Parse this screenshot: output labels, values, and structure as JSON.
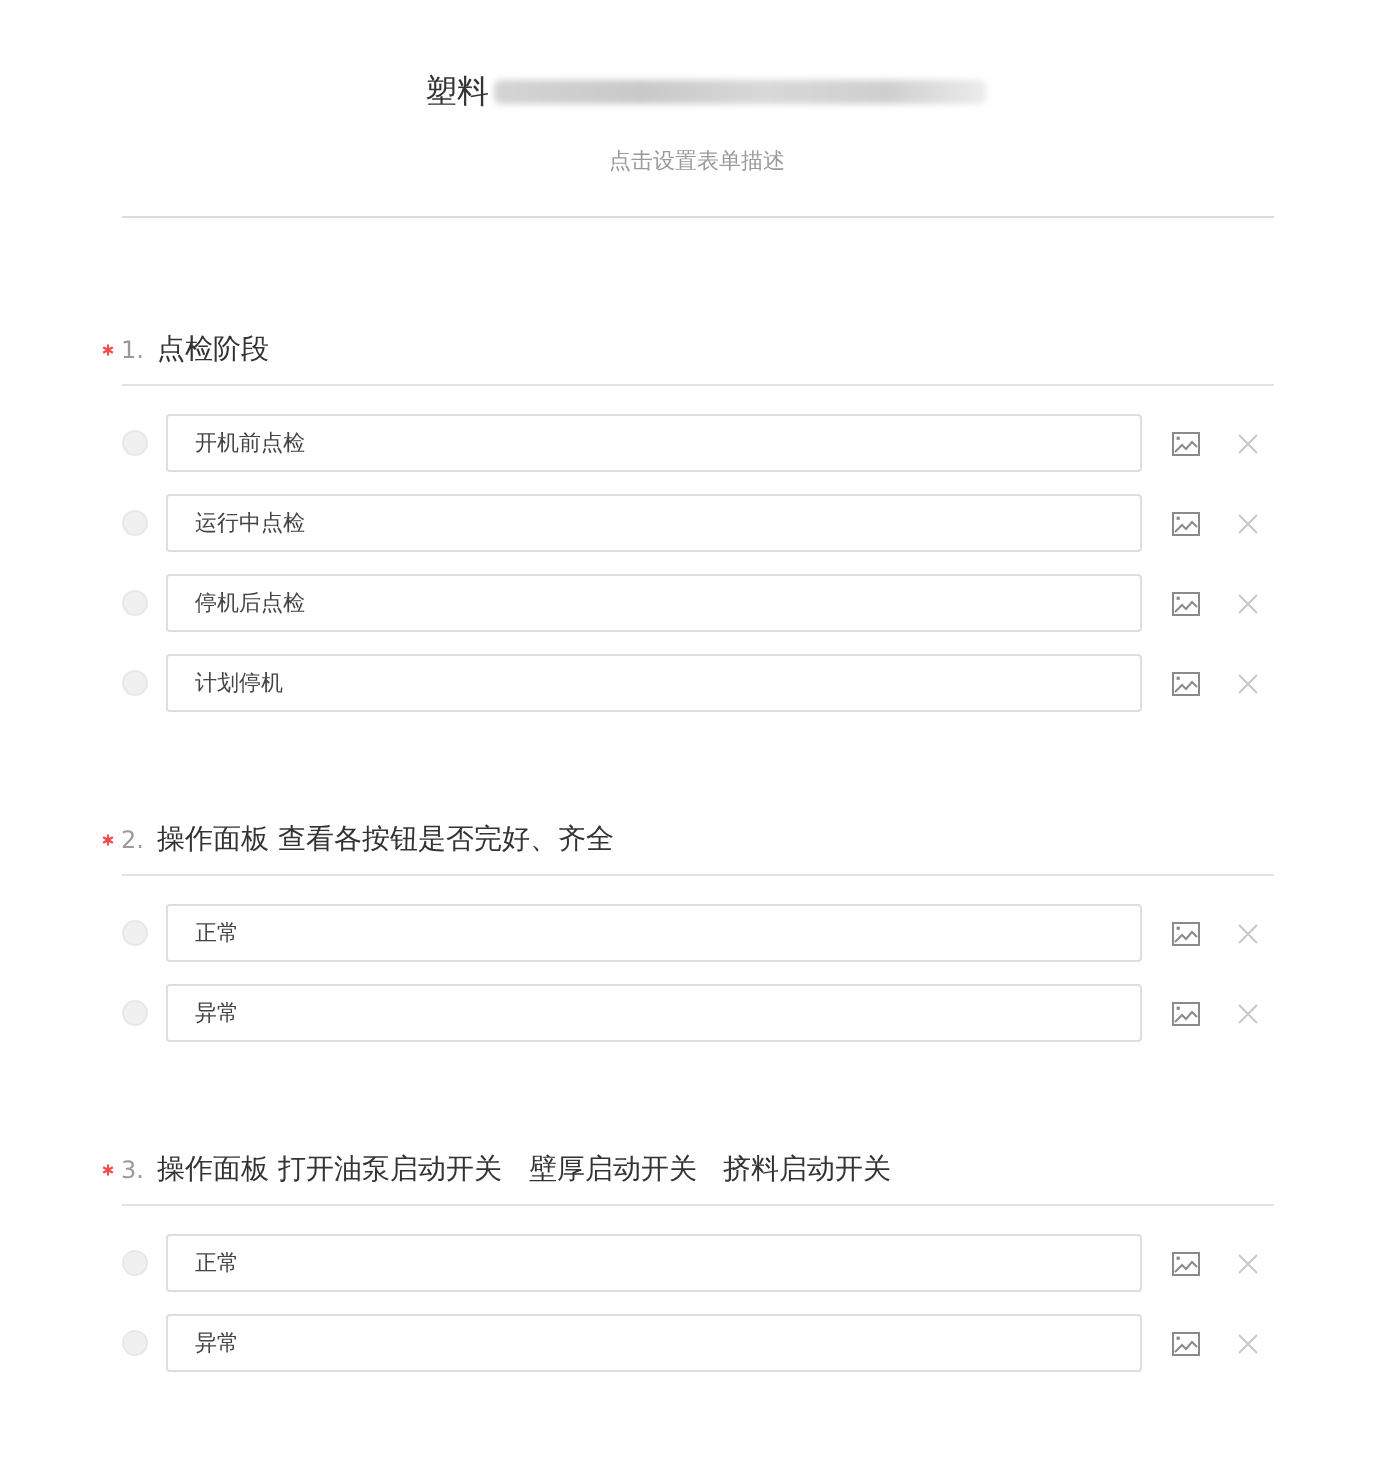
{
  "form": {
    "title": "塑料",
    "title_blurred": true,
    "description": "点击设置表单描述"
  },
  "questions": [
    {
      "number": "1.",
      "required": true,
      "title": "点检阶段",
      "options": [
        {
          "value": "开机前点检",
          "selected": false
        },
        {
          "value": "运行中点检",
          "selected": false
        },
        {
          "value": "停机后点检",
          "selected": false
        },
        {
          "value": "计划停机",
          "selected": false
        }
      ]
    },
    {
      "number": "2.",
      "required": true,
      "title": "操作面板 查看各按钮是否完好、齐全",
      "options": [
        {
          "value": "正常",
          "selected": false
        },
        {
          "value": "异常",
          "selected": false
        }
      ]
    },
    {
      "number": "3.",
      "required": true,
      "title": "操作面板 打开油泵启动开关   壁厚启动开关   挤料启动开关",
      "options": [
        {
          "value": "正常",
          "selected": false
        },
        {
          "value": "异常",
          "selected": false
        }
      ]
    }
  ]
}
